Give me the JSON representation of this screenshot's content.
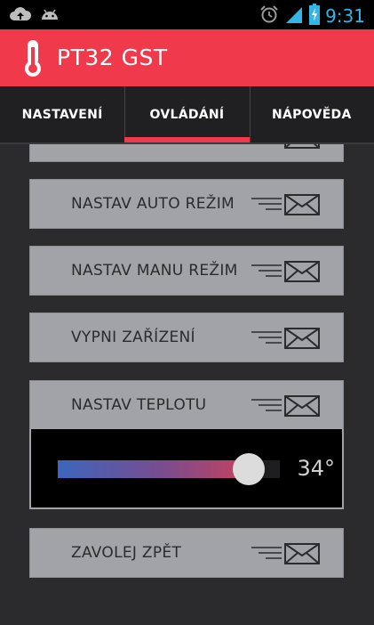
{
  "statusbar": {
    "time": "9:31",
    "left_icons": [
      "cloud-upload-icon",
      "android-icon"
    ],
    "right_icons": [
      "alarm-icon",
      "signal-icon",
      "battery-charging-icon"
    ]
  },
  "app": {
    "title": "PT32 GST",
    "icon": "thermometer-icon",
    "accent": "#f03a4b"
  },
  "tabs": [
    {
      "label": "NASTAVENÍ",
      "active": false
    },
    {
      "label": "OVLÁDÁNÍ",
      "active": true
    },
    {
      "label": "NÁPOVĚDA",
      "active": false
    }
  ],
  "commands": [
    {
      "label": "NASTAV AUTO REŽIM",
      "icon": "send-mail-icon"
    },
    {
      "label": "NASTAV MANU REŽIM",
      "icon": "send-mail-icon"
    },
    {
      "label": "VYPNI ZAŘÍZENÍ",
      "icon": "send-mail-icon"
    },
    {
      "label": "NASTAV TEPLOTU",
      "icon": "send-mail-icon"
    },
    {
      "label": "ZAVOLEJ ZPĚT",
      "icon": "send-mail-icon"
    }
  ],
  "temperature_slider": {
    "value_label": "34°",
    "fraction": 0.86
  }
}
